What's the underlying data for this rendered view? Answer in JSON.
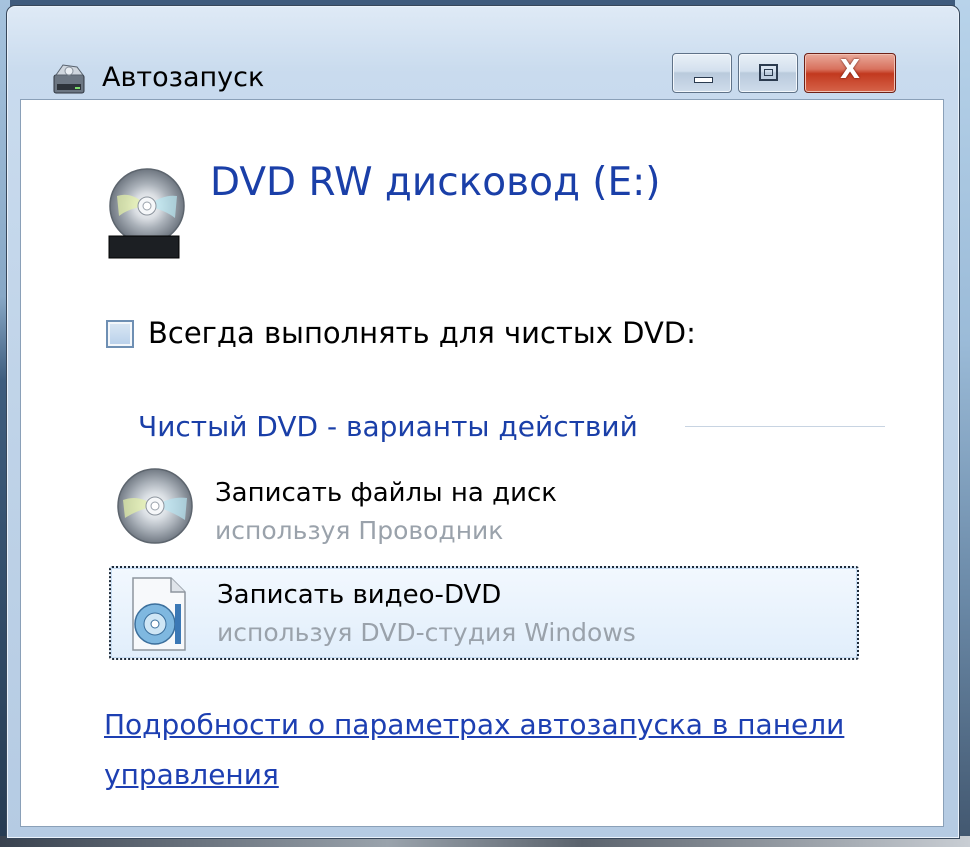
{
  "window": {
    "title": "Автозапуск",
    "controls": {
      "minimize_icon": "minimize-icon",
      "maximize_icon": "maximize-icon",
      "close_label": "X"
    }
  },
  "device": {
    "title": "DVD RW дисковод (E:)",
    "icon": "dvd-drive-icon",
    "icon_badge": "DVD-R"
  },
  "always_do": {
    "label": "Всегда выполнять для чистых DVD:",
    "checked": false
  },
  "section": {
    "title": "Чистый DVD - варианты действий"
  },
  "options": [
    {
      "title": "Записать файлы на диск",
      "subtitle": "используя Проводник",
      "icon": "cd-disc-icon",
      "selected": false
    },
    {
      "title": "Записать видео-DVD",
      "subtitle": "используя DVD-студия Windows",
      "icon": "dvd-maker-icon",
      "selected": true
    }
  ],
  "footer": {
    "link": "Подробности о параметрах автозапуска в панели управления"
  },
  "colors": {
    "heading_blue": "#1a3fa8",
    "link_blue": "#1d3fb2",
    "close_red": "#c2391f"
  }
}
